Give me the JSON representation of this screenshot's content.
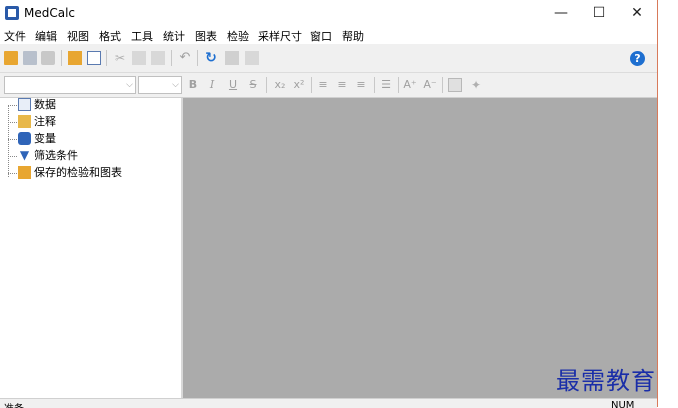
{
  "window": {
    "title": "MedCalc",
    "minimize": "—",
    "maximize": "☐",
    "close": "✕"
  },
  "menu": [
    "文件",
    "编辑",
    "视图",
    "格式",
    "工具",
    "统计",
    "图表",
    "检验",
    "采样尺寸",
    "窗口",
    "帮助"
  ],
  "toolbar": {
    "help": "?"
  },
  "format_toolbar": {
    "bold": "B",
    "italic": "I",
    "underline": "U",
    "strike": "S",
    "subscript": "x₂",
    "superscript": "x²",
    "grow_font": "A⁺",
    "shrink_font": "A⁻"
  },
  "tree": {
    "items": [
      "数据",
      "注释",
      "变量",
      "筛选条件",
      "保存的检验和图表"
    ]
  },
  "status": {
    "left": "准备",
    "right": "NUM"
  },
  "watermark": "最需教育",
  "colors": {
    "workspace": "#ababab",
    "accent": "#1e6fd0",
    "watermark": "#1a2ea8"
  }
}
